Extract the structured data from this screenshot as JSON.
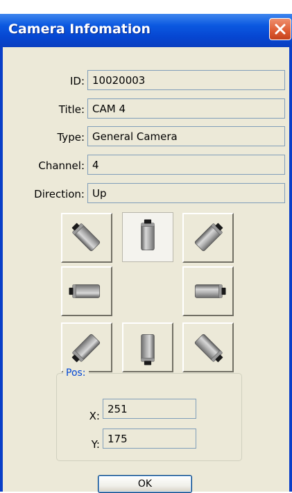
{
  "window": {
    "title": "Camera Infomation"
  },
  "fields": [
    {
      "label": "ID:",
      "value": "10020003"
    },
    {
      "label": "Title:",
      "value": "CAM 4"
    },
    {
      "label": "Type:",
      "value": "General Camera"
    },
    {
      "label": "Channel:",
      "value": "4"
    },
    {
      "label": "Direction:",
      "value": "Up"
    }
  ],
  "direction_buttons": {
    "selected": "up",
    "items": [
      "up-left",
      "up",
      "up-right",
      "left",
      "right",
      "down-left",
      "down",
      "down-right"
    ]
  },
  "pos": {
    "group_label": "Pos:",
    "x_label": "X:",
    "x_value": "251",
    "y_label": "Y:",
    "y_value": "175"
  },
  "buttons": {
    "ok_label": "OK"
  },
  "colors": {
    "title_bar": "#0b58e0",
    "client_bg": "#ece9d8",
    "close_button": "#de5b32",
    "group_title": "#0046d5"
  },
  "icons": {
    "close": "close-icon",
    "camera": "camera-icon"
  }
}
